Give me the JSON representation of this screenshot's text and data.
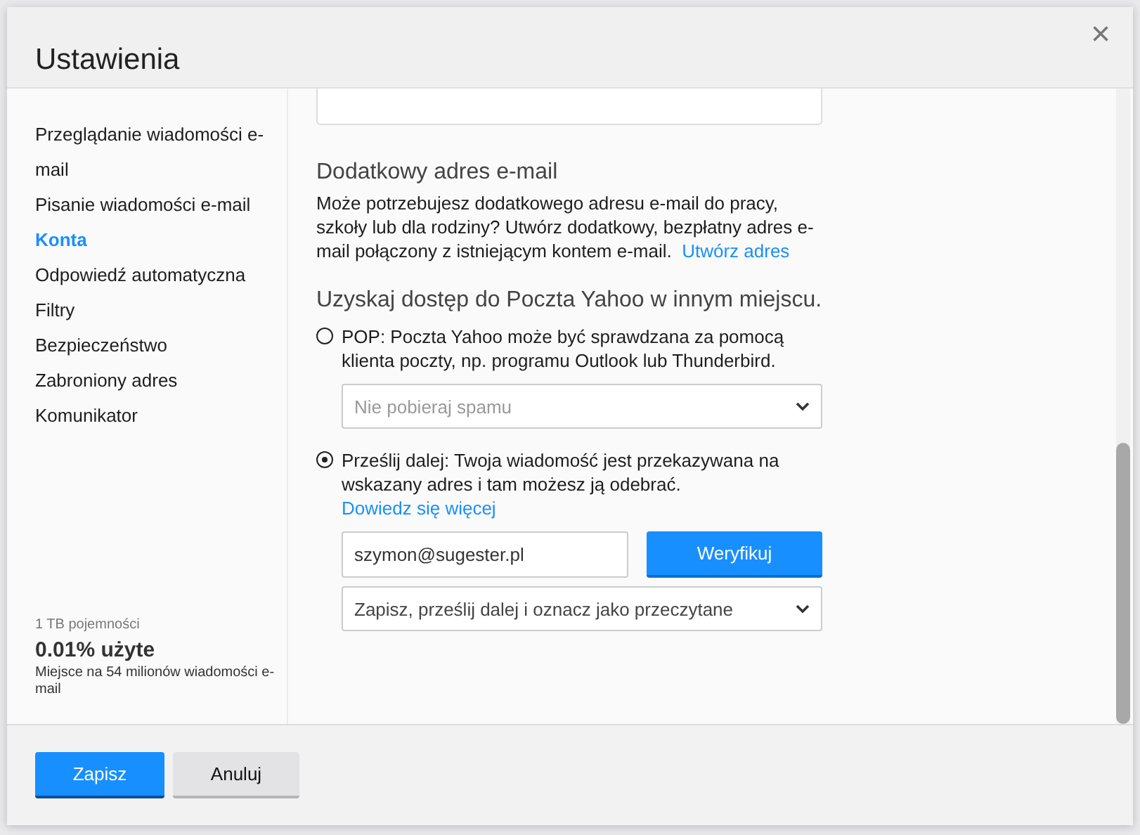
{
  "dialog": {
    "title": "Ustawienia",
    "close": "×"
  },
  "sidebar": {
    "items": [
      {
        "label": "Przeglądanie wiadomości e-mail",
        "selected": false
      },
      {
        "label": "Pisanie wiadomości e-mail",
        "selected": false
      },
      {
        "label": "Konta",
        "selected": true
      },
      {
        "label": "Odpowiedź automatyczna",
        "selected": false
      },
      {
        "label": "Filtry",
        "selected": false
      },
      {
        "label": "Bezpieczeństwo",
        "selected": false
      },
      {
        "label": "Zabroniony adres",
        "selected": false
      },
      {
        "label": "Komunikator",
        "selected": false
      }
    ],
    "storage": {
      "capacity": "1 TB pojemności",
      "used": "0.01% użyte",
      "note": "Miejsce na 54 milionów wiadomości e-mail"
    }
  },
  "extra_address": {
    "heading": "Dodatkowy adres e-mail",
    "text": "Może potrzebujesz dodatkowego adresu e-mail do pracy, szkoły lub dla rodziny? Utwórz dodatkowy, bezpłatny adres e-mail połączony z istniejącym kontem e-mail.",
    "link": "Utwórz adres"
  },
  "access": {
    "heading": "Uzyskaj dostęp do Poczta Yahoo w innym miejscu.",
    "options": [
      {
        "text": "POP: Poczta Yahoo może być sprawdzana za pomocą klienta poczty, np. programu Outlook lub Thunderbird.",
        "selected": false,
        "select": {
          "placeholder": "Nie pobieraj spamu"
        }
      },
      {
        "text": "Prześlij dalej: Twoja wiadomość jest przekazywana na wskazany adres i tam możesz ją odebrać.",
        "link": "Dowiedz się więcej",
        "selected": true,
        "email": "szymon@sugester.pl",
        "verify": "Weryfikuj",
        "select": {
          "value": "Zapisz, prześlij dalej i oznacz jako przeczytane"
        }
      }
    ]
  },
  "buttons": [
    {
      "label": "Zapisz",
      "kind": "primary"
    },
    {
      "label": "Anuluj",
      "kind": "secondary"
    }
  ]
}
